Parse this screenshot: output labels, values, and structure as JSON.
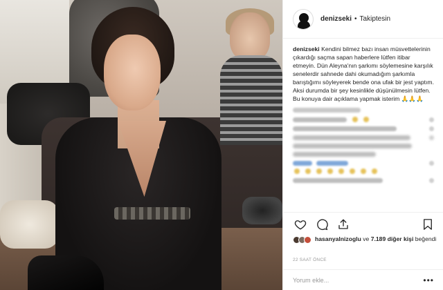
{
  "header": {
    "username": "denizseki",
    "separator": "•",
    "follow_status": "Takiptesin"
  },
  "caption": {
    "username": "denizseki",
    "text": "Kendini bilmez bazı insan müsvettelerinin çıkardığı saçma sapan haberlere lütfen itibar etmeyin. Dün Aleyna'nın şarkımı söylemesine karşılık senelerdir sahnede dahi okumadığım şarkımla barıştığımı söyleyerek bende ona ufak bir jest yaptım. Aksi durumda bir şey kesinlikle düşünülmesin lütfen. Bu konuya dair açıklama yapmak isterim",
    "emoji": "🙏🙏🙏"
  },
  "likes": {
    "user": "hasanyalnizoglu",
    "connector": "ve",
    "count_text": "7.189 diğer kişi",
    "suffix": "beğendi"
  },
  "time": "22 SAAT ÖNCE",
  "comment_box": {
    "placeholder": "Yorum ekle...",
    "more": "•••"
  },
  "icons": {
    "like": "heart-icon",
    "comment": "comment-icon",
    "share": "share-icon",
    "save": "bookmark-icon"
  },
  "colors": {
    "text": "#262626",
    "muted": "#999999",
    "border": "#efefef"
  }
}
